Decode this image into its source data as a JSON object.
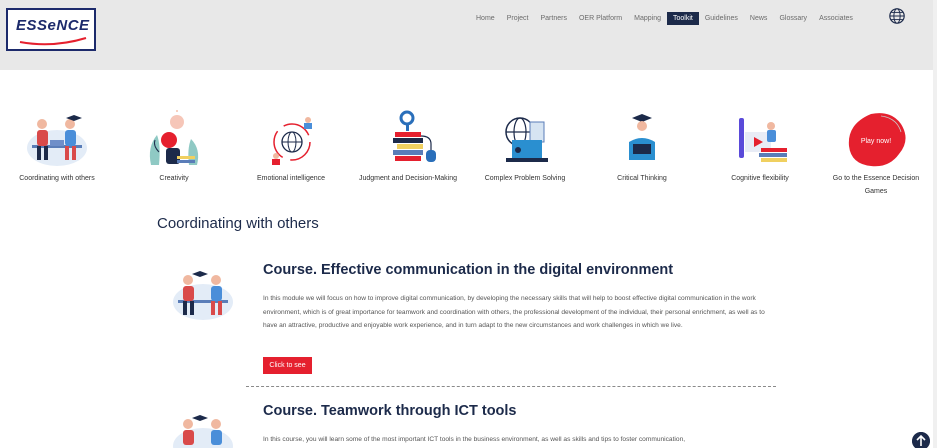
{
  "header": {
    "logo_text": "ESSeNCE",
    "nav": [
      "Home",
      "Project",
      "Partners",
      "OER Platform",
      "Mapping",
      "Toolkit",
      "Guidelines",
      "News",
      "Glossary",
      "Associates"
    ],
    "active_nav": "Toolkit"
  },
  "skills": [
    {
      "label": "Coordinating with others",
      "icon": "people-meeting-icon"
    },
    {
      "label": "Creativity",
      "icon": "lightbulb-creativity-icon"
    },
    {
      "label": "Emotional intelligence",
      "icon": "emotional-globe-icon"
    },
    {
      "label": "Judgment and Decision-Making",
      "icon": "books-magnifier-icon"
    },
    {
      "label": "Complex Problem Solving",
      "icon": "laptop-globe-icon"
    },
    {
      "label": "Critical Thinking",
      "icon": "graduate-reader-icon"
    },
    {
      "label": "Cognitive flexibility",
      "icon": "video-books-icon"
    },
    {
      "label": "Go to the Essence Decision Games",
      "icon": "play-now-blob-icon",
      "badge": "Play now!"
    }
  ],
  "section_title": "Coordinating with others",
  "courses": [
    {
      "title": "Course. Effective communication in the digital environment",
      "description": "In this module we will focus on how to improve digital communication, by developing the necessary skills that will help to boost effective digital communication in the work environment, which is of great importance for teamwork and coordination with others, the professional development of the individual, their personal enrichment, as well as to have an attractive, productive and enjoyable work experience, and in turn adapt to the new circumstances and work challenges in which we live.",
      "button": "Click to see"
    },
    {
      "title": "Course. Teamwork through ICT tools",
      "description": "In this course, you will learn some of the most important ICT tools in the business environment, as well as skills and tips to foster communication,"
    }
  ],
  "colors": {
    "navy": "#1c2a4a",
    "accent_red": "#e5202e",
    "header_bg": "#e8e8e8"
  }
}
